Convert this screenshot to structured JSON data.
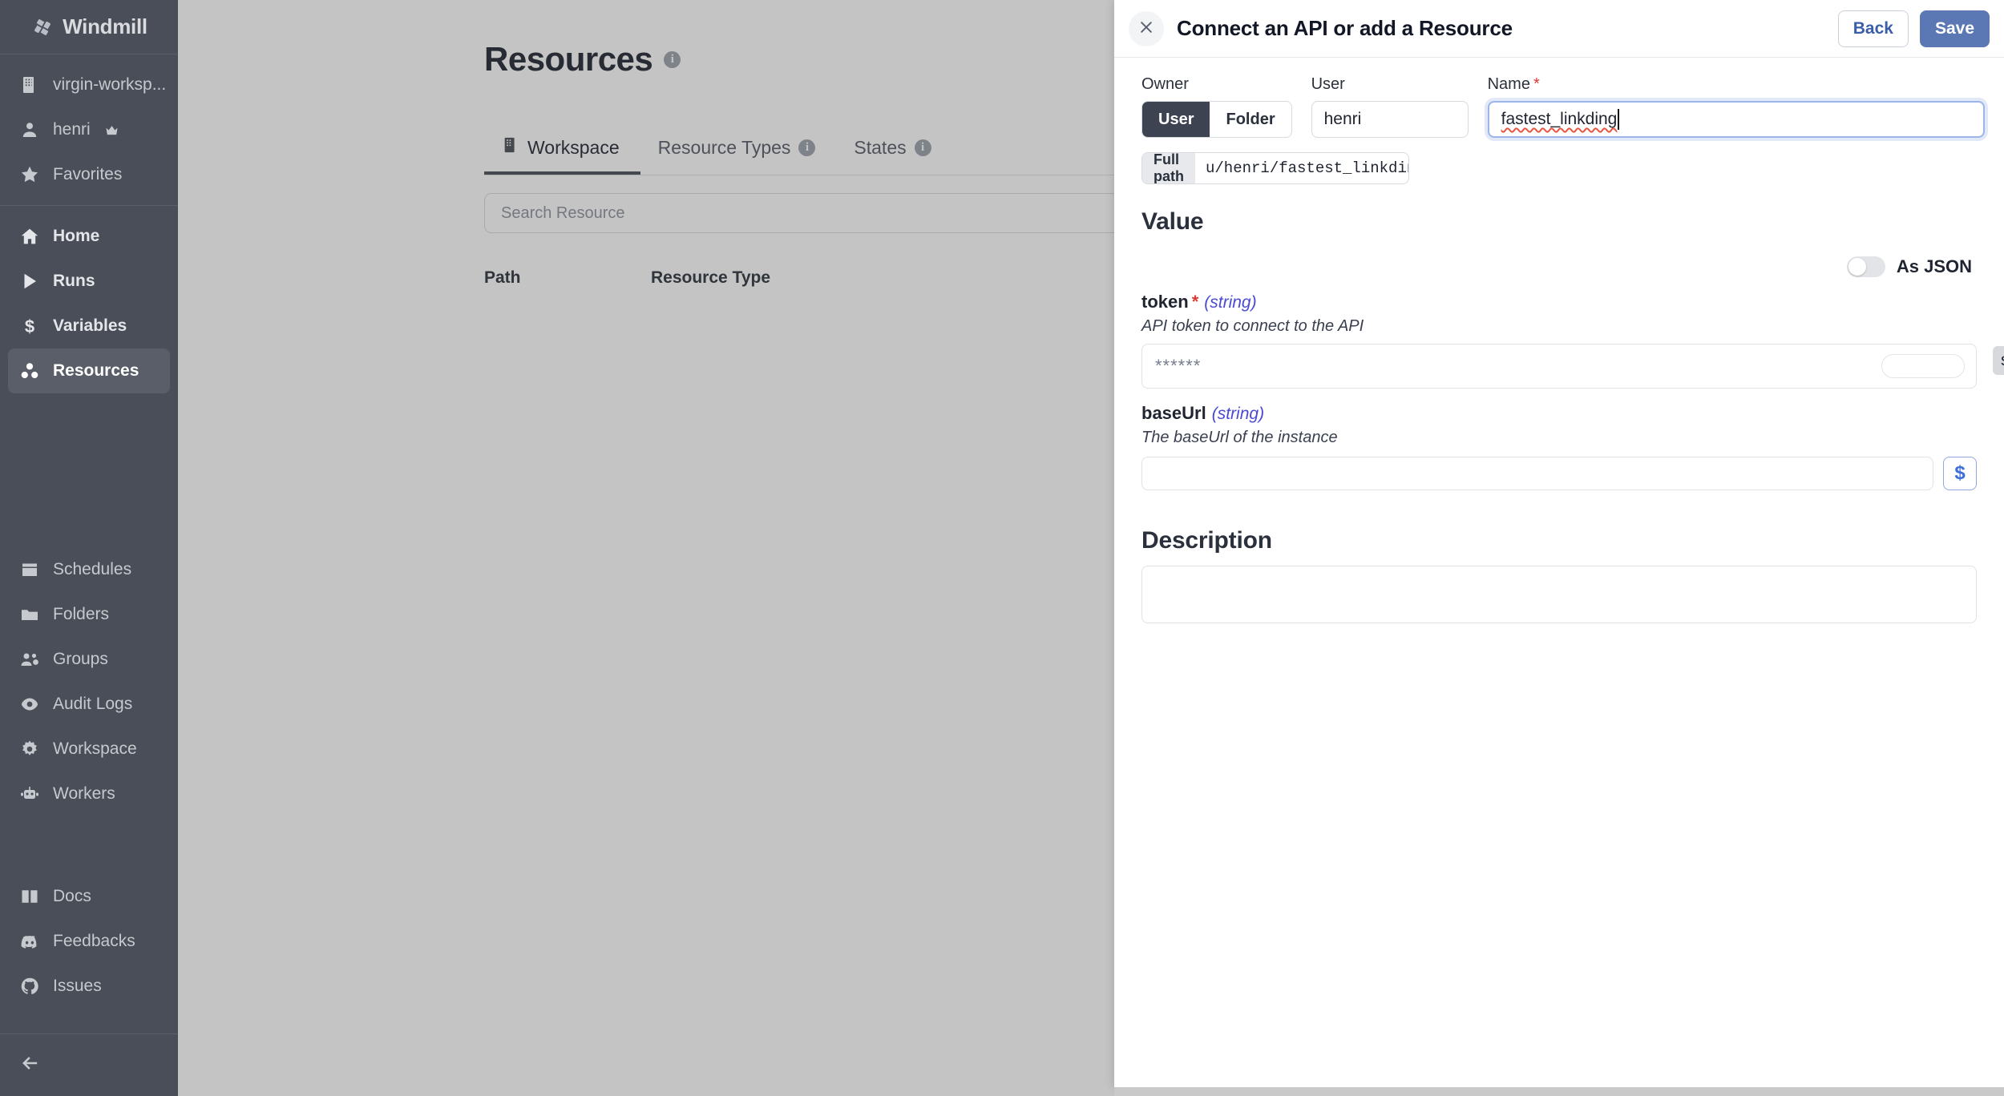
{
  "sidebar": {
    "brand": "Windmill",
    "workspace": {
      "label": "virgin-worksp...",
      "icon": "building-icon"
    },
    "user": {
      "label": "henri",
      "icon": "user-icon",
      "badge": "crown-icon"
    },
    "favorites": {
      "label": "Favorites",
      "icon": "star-icon"
    },
    "main_items": [
      {
        "label": "Home",
        "icon": "home-icon"
      },
      {
        "label": "Runs",
        "icon": "play-icon"
      },
      {
        "label": "Variables",
        "icon": "dollar-icon"
      },
      {
        "label": "Resources",
        "icon": "resources-icon",
        "active": true
      }
    ],
    "admin_items": [
      {
        "label": "Schedules",
        "icon": "calendar-icon"
      },
      {
        "label": "Folders",
        "icon": "folder-icon"
      },
      {
        "label": "Groups",
        "icon": "groups-icon"
      },
      {
        "label": "Audit Logs",
        "icon": "eye-icon"
      },
      {
        "label": "Workspace",
        "icon": "gear-icon"
      },
      {
        "label": "Workers",
        "icon": "robot-icon"
      }
    ],
    "footer_items": [
      {
        "label": "Docs",
        "icon": "book-icon"
      },
      {
        "label": "Feedbacks",
        "icon": "discord-icon"
      },
      {
        "label": "Issues",
        "icon": "github-icon"
      }
    ],
    "collapse": {
      "icon": "arrow-left-icon"
    }
  },
  "page": {
    "title": "Resources",
    "title_info": "i",
    "tabs": [
      {
        "label": "Workspace",
        "icon": "building-icon",
        "active": true,
        "info": ""
      },
      {
        "label": "Resource Types",
        "icon": "",
        "active": false,
        "info": "i"
      },
      {
        "label": "States",
        "icon": "",
        "active": false,
        "info": "i"
      }
    ],
    "search_placeholder": "Search Resource",
    "table_headers": [
      "Path",
      "Resource Type"
    ]
  },
  "drawer": {
    "title": "Connect an API or add a Resource",
    "close_icon": "close-icon",
    "back_label": "Back",
    "save_label": "Save",
    "owner": {
      "label": "Owner",
      "options": [
        "User",
        "Folder"
      ],
      "selected": "User"
    },
    "user": {
      "label": "User",
      "value": "henri"
    },
    "name": {
      "label": "Name",
      "required_mark": "*",
      "value": "fastest_linkding"
    },
    "full_path": {
      "label": "Full path",
      "value": "u/henri/fastest_linkding"
    },
    "value_section": {
      "title": "Value",
      "as_json_label": "As JSON",
      "as_json_on": false,
      "properties": [
        {
          "name": "token",
          "required_mark": "*",
          "type": "(string)",
          "description": "API token to connect to the API",
          "value": "******",
          "is_password": true,
          "show_tooltip": "show"
        },
        {
          "name": "baseUrl",
          "required_mark": "",
          "type": "(string)",
          "description": "The baseUrl of the instance",
          "value": "",
          "is_password": false,
          "action_button": "$"
        }
      ]
    },
    "description_section": {
      "title": "Description",
      "value": ""
    }
  },
  "colors": {
    "sidebar_bg": "#4a4e58",
    "accent_save": "#5b78b4",
    "accent_link": "#3b5ea9",
    "required_red": "#dc3a34",
    "type_purple": "#4a4ad4",
    "scrim": "rgba(60,60,60,0.30)"
  }
}
